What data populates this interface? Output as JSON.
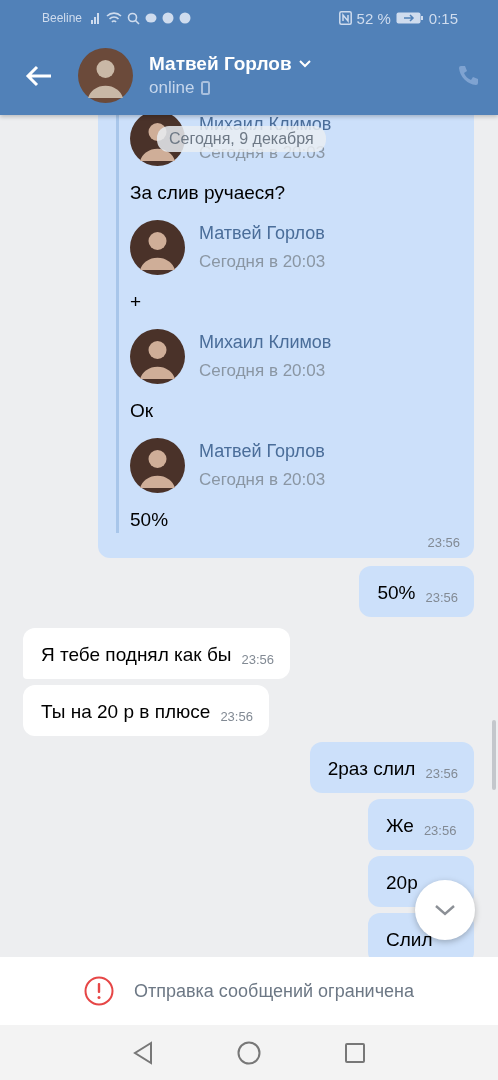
{
  "status_bar": {
    "carrier": "Beeline",
    "battery": "52 %",
    "time": "0:15"
  },
  "header": {
    "name": "Матвей Горлов",
    "status": "online"
  },
  "date_pill": "Сегодня, 9 декабря",
  "messages": [
    {
      "kind": "forwarded",
      "outgoing": true,
      "time": "23:56",
      "items": [
        {
          "kind": "author",
          "name": "Михаил Климов",
          "time": "Сегодня в 20:03"
        },
        {
          "kind": "text",
          "text": "За слив ручаеся?"
        },
        {
          "kind": "author",
          "name": "Матвей Горлов",
          "time": "Сегодня в 20:03"
        },
        {
          "kind": "text",
          "text": "+"
        },
        {
          "kind": "author",
          "name": "Михаил Климов",
          "time": "Сегодня в 20:03"
        },
        {
          "kind": "text",
          "text": "Ок"
        },
        {
          "kind": "author",
          "name": "Матвей Горлов",
          "time": "Сегодня в 20:03"
        },
        {
          "kind": "text",
          "text": "50%"
        }
      ]
    },
    {
      "kind": "text",
      "outgoing": true,
      "text": "50%",
      "time": "23:56",
      "tail": false
    },
    {
      "kind": "text",
      "outgoing": false,
      "text": "Я тебе поднял как бы",
      "time": "23:56",
      "tail": true
    },
    {
      "kind": "text",
      "outgoing": false,
      "text": "Ты на 20 р в плюсе",
      "time": "23:56",
      "tail": false
    },
    {
      "kind": "text",
      "outgoing": true,
      "text": "2раз слил",
      "time": "23:56",
      "tail": false
    },
    {
      "kind": "text",
      "outgoing": true,
      "text": "Же",
      "time": "23:56",
      "tail": false
    },
    {
      "kind": "text",
      "outgoing": true,
      "text": "20р",
      "tail": false
    },
    {
      "kind": "text",
      "outgoing": true,
      "text": "Слил",
      "tail": false
    }
  ],
  "notice": "Отправка сообщений ограничена"
}
